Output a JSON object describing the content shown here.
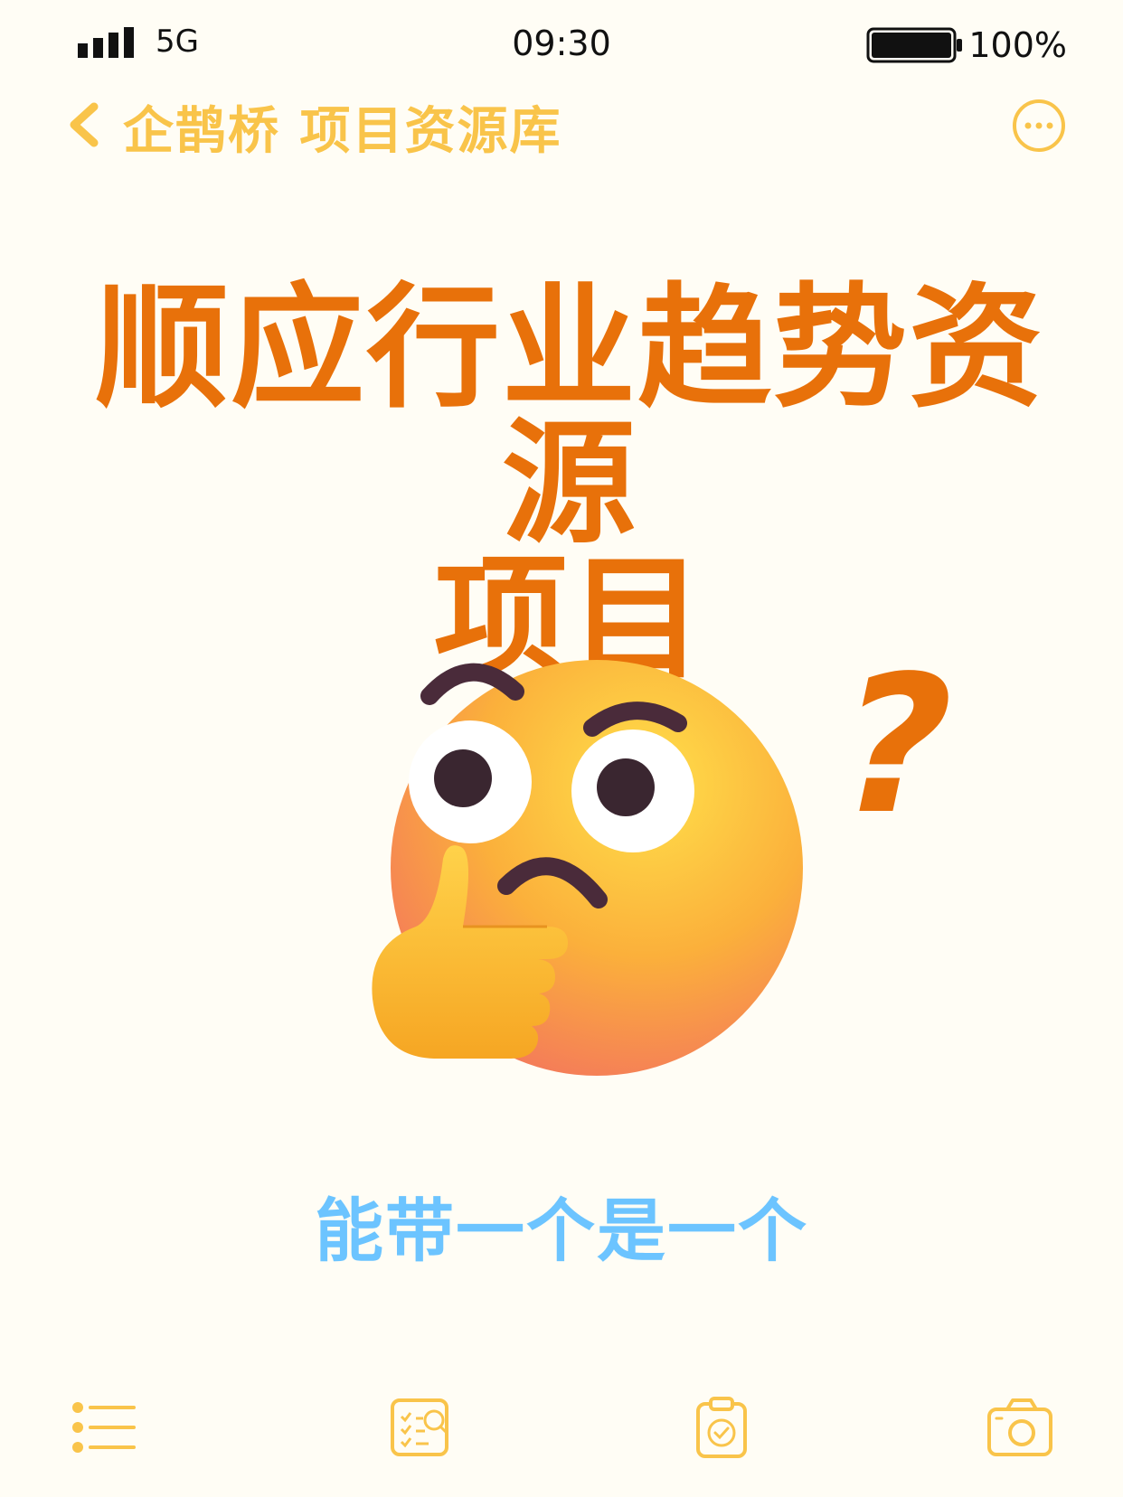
{
  "status_bar": {
    "network": "5G",
    "time": "09:30",
    "battery": "100%"
  },
  "nav": {
    "title": "企鹊桥 项目资源库",
    "back_icon": "chevron-left-icon",
    "more_icon": "more-icon"
  },
  "headline": {
    "line1": "顺应行业趋势资源",
    "line2": "项目"
  },
  "emoji": {
    "icon": "thinking-face-icon",
    "question_mark": "?"
  },
  "subtitle": "能带一个是一个",
  "toolbar": {
    "icons": [
      "list-icon",
      "checklist-search-icon",
      "clipboard-check-icon",
      "camera-icon"
    ]
  },
  "colors": {
    "accent": "#f9c44a",
    "headline": "#e8710a",
    "subtitle": "#6cc4ff",
    "background": "#fffdf5"
  }
}
